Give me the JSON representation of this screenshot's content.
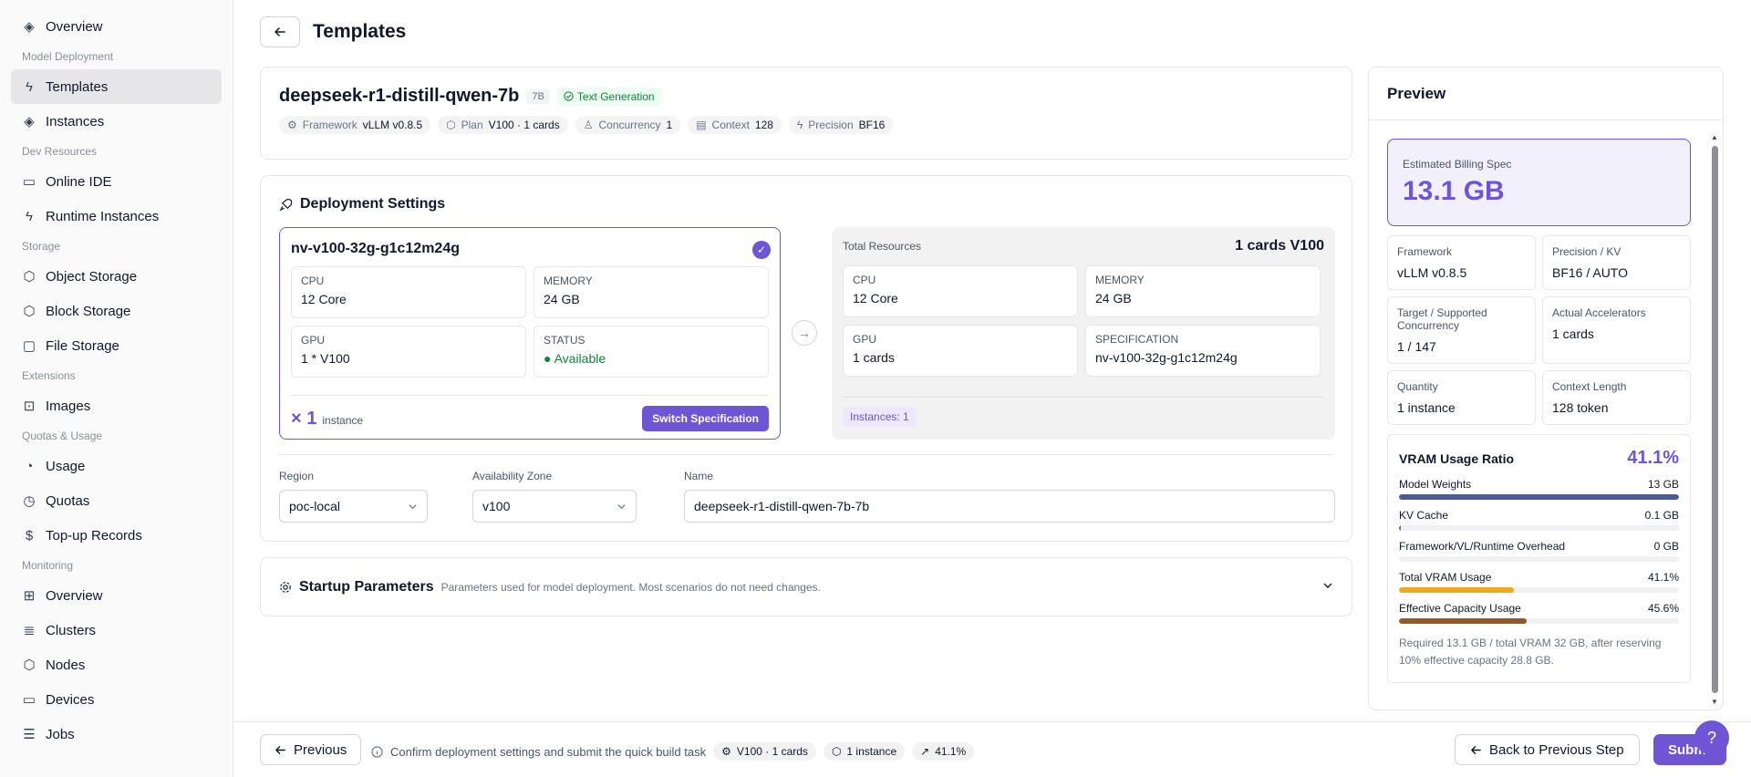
{
  "sidebar": {
    "items": [
      {
        "type": "item",
        "label": "Overview",
        "icon": "layers-icon"
      },
      {
        "type": "section",
        "label": "Model Deployment"
      },
      {
        "type": "item",
        "label": "Templates",
        "icon": "zap-icon",
        "active": true
      },
      {
        "type": "item",
        "label": "Instances",
        "icon": "layers-icon"
      },
      {
        "type": "section",
        "label": "Dev Resources"
      },
      {
        "type": "item",
        "label": "Online IDE",
        "icon": "code-icon"
      },
      {
        "type": "item",
        "label": "Runtime Instances",
        "icon": "zap-icon"
      },
      {
        "type": "section",
        "label": "Storage"
      },
      {
        "type": "item",
        "label": "Object Storage",
        "icon": "box-icon"
      },
      {
        "type": "item",
        "label": "Block Storage",
        "icon": "box-icon"
      },
      {
        "type": "item",
        "label": "File Storage",
        "icon": "file-icon"
      },
      {
        "type": "section",
        "label": "Extensions"
      },
      {
        "type": "item",
        "label": "Images",
        "icon": "image-icon"
      },
      {
        "type": "section",
        "label": "Quotas & Usage"
      },
      {
        "type": "item",
        "label": "Usage",
        "icon": "gauge-icon"
      },
      {
        "type": "item",
        "label": "Quotas",
        "icon": "clock-icon"
      },
      {
        "type": "item",
        "label": "Top-up Records",
        "icon": "dollar-icon"
      },
      {
        "type": "section",
        "label": "Monitoring"
      },
      {
        "type": "item",
        "label": "Overview",
        "icon": "grid-icon"
      },
      {
        "type": "item",
        "label": "Clusters",
        "icon": "server-icon"
      },
      {
        "type": "item",
        "label": "Nodes",
        "icon": "box-icon"
      },
      {
        "type": "item",
        "label": "Devices",
        "icon": "monitor-icon"
      },
      {
        "type": "item",
        "label": "Jobs",
        "icon": "list-icon"
      }
    ]
  },
  "header": {
    "title": "Templates"
  },
  "model": {
    "name": "deepseek-r1-distill-qwen-7b",
    "size_badge": "7B",
    "task_badge": "Text Generation",
    "chips": [
      {
        "label": "Framework",
        "value": "vLLM v0.8.5",
        "icon": "gear-icon"
      },
      {
        "label": "Plan",
        "value": "V100 · 1 cards",
        "icon": "cube-icon"
      },
      {
        "label": "Concurrency",
        "value": "1",
        "icon": "user-icon"
      },
      {
        "label": "Context",
        "value": "128",
        "icon": "doc-icon"
      },
      {
        "label": "Precision",
        "value": "BF16",
        "icon": "zap-icon"
      }
    ]
  },
  "deploy": {
    "title": "Deployment Settings",
    "spec": {
      "name": "nv-v100-32g-g1c12m24g",
      "cells": [
        {
          "label": "CPU",
          "value": "12 Core"
        },
        {
          "label": "MEMORY",
          "value": "24 GB"
        },
        {
          "label": "GPU",
          "value": "1 * V100"
        },
        {
          "label": "STATUS",
          "value": "● Available"
        }
      ],
      "qty_prefix": "× 1",
      "qty_unit": "instance",
      "switch_label": "Switch Specification"
    },
    "total": {
      "label": "Total Resources",
      "summary": "1 cards V100",
      "cells": [
        {
          "label": "CPU",
          "value": "12 Core"
        },
        {
          "label": "MEMORY",
          "value": "24 GB"
        },
        {
          "label": "GPU",
          "value": "1 cards"
        },
        {
          "label": "SPECIFICATION",
          "value": "nv-v100-32g-g1c12m24g"
        }
      ],
      "instances_badge": "Instances: 1"
    },
    "region": {
      "label": "Region",
      "value": "poc-local"
    },
    "zone": {
      "label": "Availability Zone",
      "value": "v100"
    },
    "name": {
      "label": "Name",
      "value": "deepseek-r1-distill-qwen-7b-7b"
    }
  },
  "startup": {
    "title": "Startup Parameters",
    "desc": "Parameters used for model deployment. Most scenarios do not need changes."
  },
  "preview": {
    "title": "Preview",
    "billing_label": "Estimated Billing Spec",
    "billing_value": "13.1 GB",
    "cells": [
      {
        "label": "Framework",
        "value": "vLLM v0.8.5"
      },
      {
        "label": "Precision / KV",
        "value": "BF16 / AUTO"
      },
      {
        "label": "Target / Supported Concurrency",
        "value": "1 / 147"
      },
      {
        "label": "Actual Accelerators",
        "value": "1 cards"
      },
      {
        "label": "Quantity",
        "value": "1 instance"
      },
      {
        "label": "Context Length",
        "value": "128 token"
      }
    ],
    "vram": {
      "title": "VRAM Usage Ratio",
      "percent": "41.1%",
      "bars": [
        {
          "label": "Model Weights",
          "value": "13 GB",
          "fill": 1.0,
          "color": "#4b5b93"
        },
        {
          "label": "KV Cache",
          "value": "0.1 GB",
          "fill": 0.004,
          "color": "#6d55d6"
        },
        {
          "label": "Framework/VL/Runtime Overhead",
          "value": "0 GB",
          "fill": 0.0,
          "color": "#6d55d6"
        },
        {
          "label": "Total VRAM Usage",
          "value": "41.1%",
          "fill": 0.411,
          "color": "#f0a81c"
        },
        {
          "label": "Effective Capacity Usage",
          "value": "45.6%",
          "fill": 0.456,
          "color": "#8f5a2e"
        }
      ],
      "note": "Required 13.1 GB / total VRAM 32 GB, after reserving 10% effective capacity 28.8 GB."
    }
  },
  "footer": {
    "previous_label": "Previous",
    "info": "Confirm deployment settings and submit the quick build task",
    "chips": [
      "V100 · 1 cards",
      "1 instance",
      "41.1%"
    ],
    "back_label": "Back to Previous Step",
    "submit_label": "Submit"
  },
  "colors": {
    "accent": "#6d55d6",
    "success": "#15803d"
  }
}
